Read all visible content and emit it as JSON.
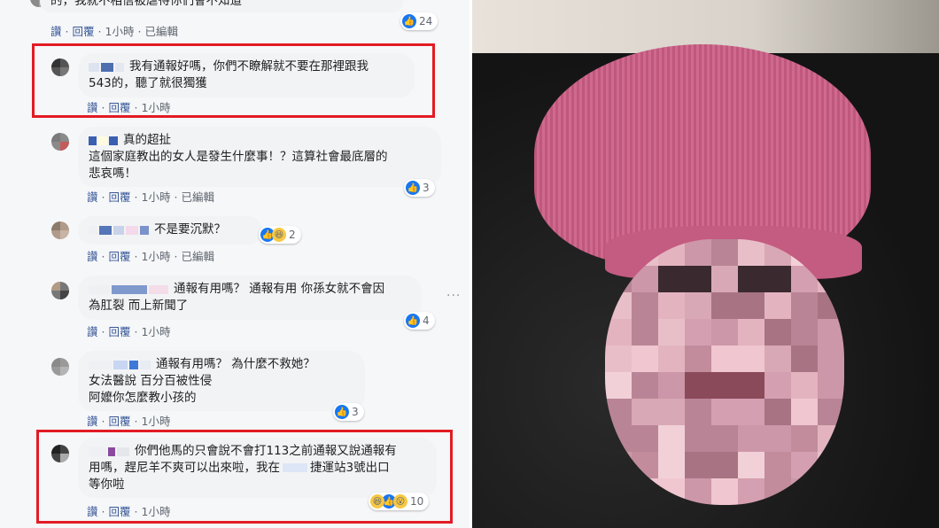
{
  "comments": [
    {
      "text": "的，我就不相信被虐待你們會不知道",
      "actions": [
        "讚",
        "回覆"
      ],
      "time": "1小時",
      "edited": "已編輯",
      "reaction_count": "24"
    },
    {
      "text": "我有通報好嗎，你們不瞭解就不要在那裡跟我\n543的，聽了就很獨獲",
      "actions": [
        "讚",
        "回覆"
      ],
      "time": "1小時",
      "edited": ""
    },
    {
      "text": "真的超扯\n這個家庭教出的女人是發生什麼事！？這算社會最底層的\n悲哀嗎！",
      "actions": [
        "讚",
        "回覆"
      ],
      "time": "1小時",
      "edited": "已編輯",
      "reaction_count": "3"
    },
    {
      "text": "不是要沉默？",
      "actions": [
        "讚",
        "回覆"
      ],
      "time": "1小時",
      "edited": "已編輯",
      "reaction_count": "2"
    },
    {
      "text": "通報有用嗎？ 通報有用 你孫女就不會因\n為肛裂 而上新聞了",
      "actions": [
        "讚",
        "回覆"
      ],
      "time": "1小時",
      "edited": "",
      "reaction_count": "4"
    },
    {
      "text": "通報有用嗎？ 為什麼不救她？\n女法醫說 百分百被性侵\n阿嬤你怎麼教小孩的",
      "actions": [
        "讚",
        "回覆"
      ],
      "time": "1小時",
      "edited": "",
      "reaction_count": "3"
    },
    {
      "text_line1": "你們他馬的只會說不會打113之前通報又說通報有",
      "text_line2": "用嗎，趕尼羊不爽可以出來啦，我在",
      "text_line2b": "捷運站3號出口",
      "text_line3": "等你啦",
      "actions": [
        "讚",
        "回覆"
      ],
      "time": "1小時",
      "edited": "",
      "reaction_count": "10"
    }
  ],
  "more_options": "···",
  "colors": {
    "link": "#385898",
    "highlight_box": "#e21b24",
    "like_blue": "#1877f2"
  },
  "icons": [
    "like-icon",
    "haha-icon",
    "wow-icon",
    "more-options-icon",
    "avatar"
  ]
}
